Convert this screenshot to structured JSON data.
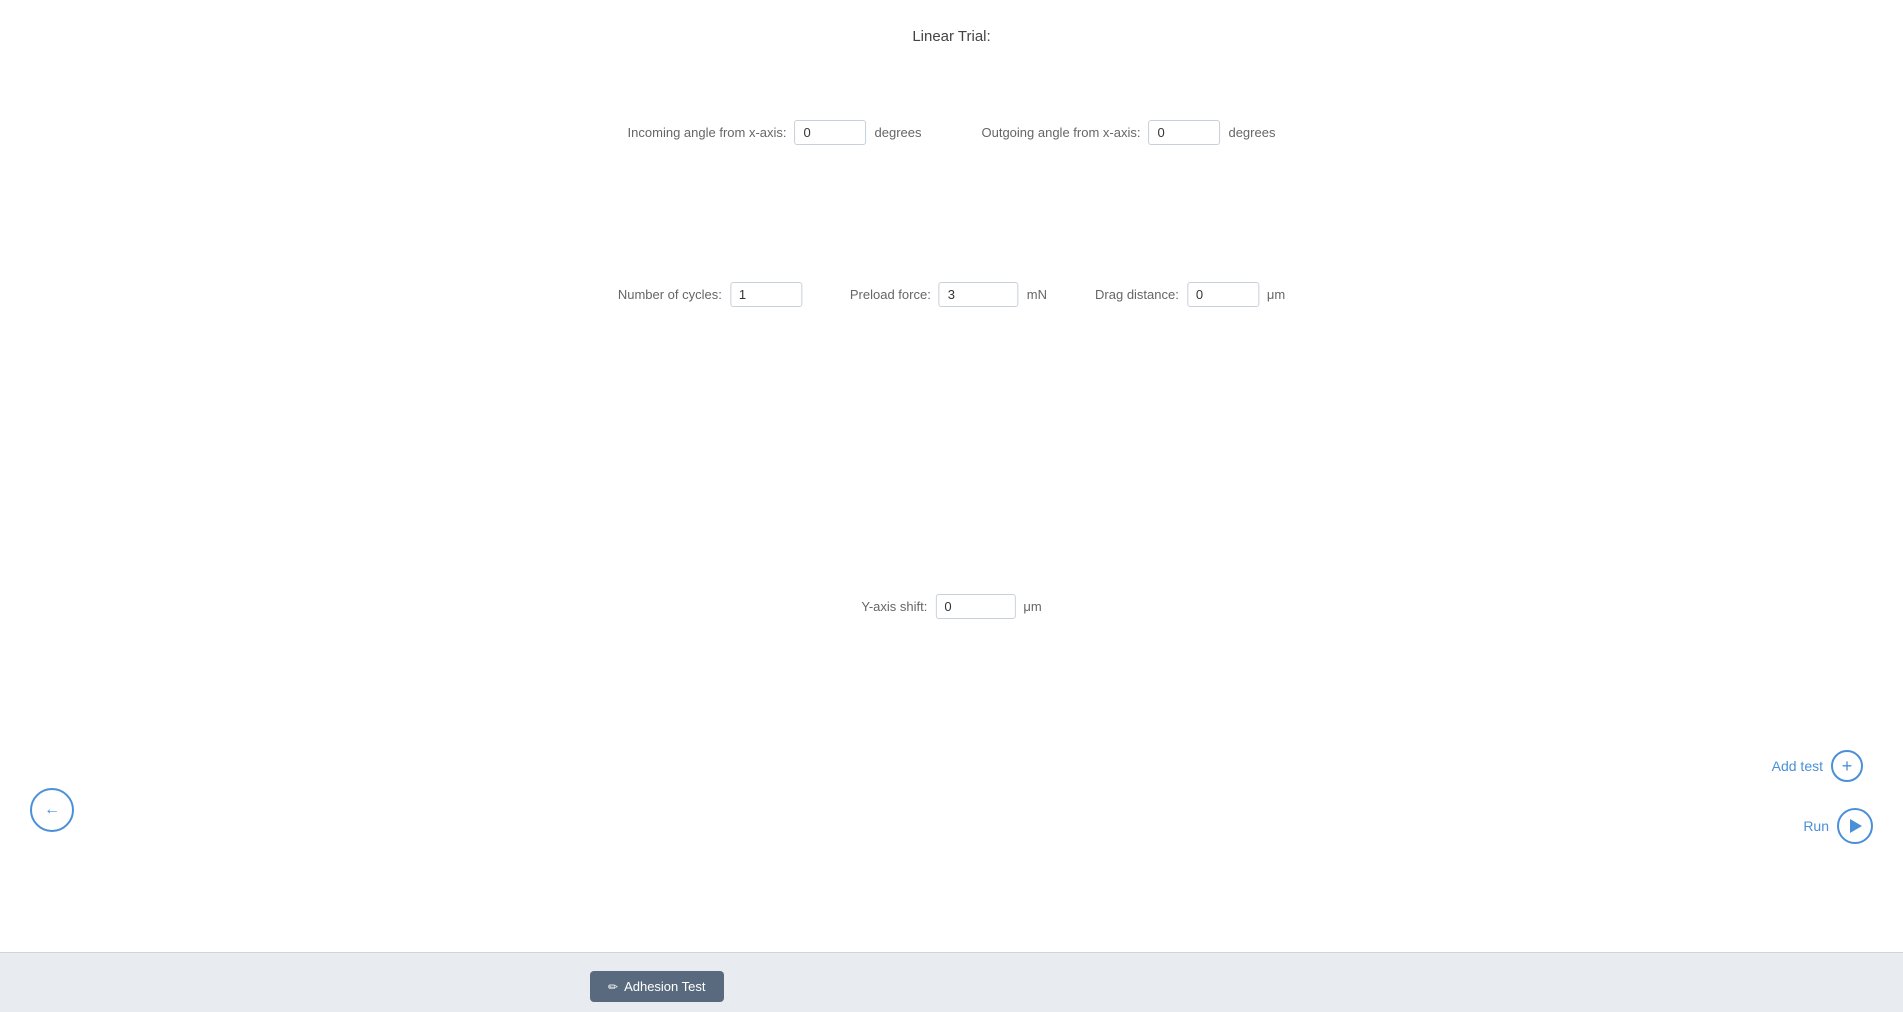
{
  "page": {
    "title": "Linear Trial:",
    "background": "#ffffff"
  },
  "fields": {
    "incoming_angle_label": "Incoming angle from x-axis:",
    "incoming_angle_value": "0",
    "incoming_angle_unit": "degrees",
    "outgoing_angle_label": "Outgoing angle from x-axis:",
    "outgoing_angle_value": "0",
    "outgoing_angle_unit": "degrees",
    "num_cycles_label": "Number of cycles:",
    "num_cycles_value": "1",
    "preload_force_label": "Preload force:",
    "preload_force_value": "3",
    "preload_force_unit": "mN",
    "drag_distance_label": "Drag distance:",
    "drag_distance_value": "0",
    "drag_distance_unit": "μm",
    "yaxis_shift_label": "Y-axis shift:",
    "yaxis_shift_value": "0",
    "yaxis_shift_unit": "μm"
  },
  "buttons": {
    "back_label": "←",
    "add_test_label": "Add test",
    "run_label": "Run",
    "tab_label": "Adhesion Test"
  }
}
